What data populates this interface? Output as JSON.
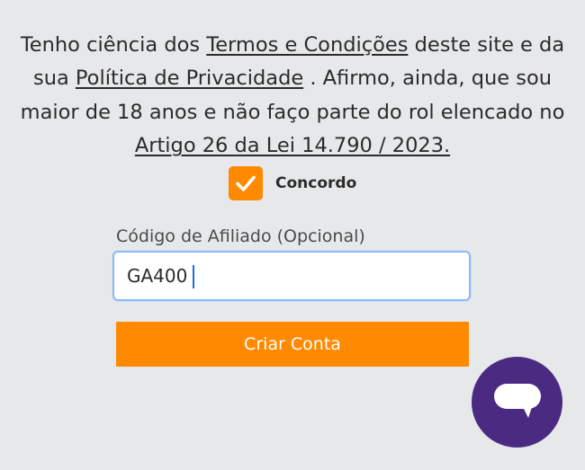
{
  "terms": {
    "intro": "Tenho ciência dos ",
    "terms_link": "Termos e Condições",
    "mid1": " deste site e da sua ",
    "privacy_link": "Política de Privacidade",
    "mid2": " . Afirmo, ainda, que sou maior de 18 anos e não faço parte do rol elencado no ",
    "law_link": "Artigo 26 da Lei 14.790 / 2023."
  },
  "agree": {
    "label": "Concordo",
    "checked": true
  },
  "affiliate": {
    "label": "Código de Afiliado (Opcional)",
    "value": "GA400"
  },
  "create_account": {
    "label": "Criar Conta"
  },
  "colors": {
    "accent": "#ff8a00",
    "chat": "#4b2a82",
    "focus_border": "#8ab9f3"
  },
  "icons": {
    "checkbox": "checkmark-icon",
    "chat": "chat-icon"
  }
}
